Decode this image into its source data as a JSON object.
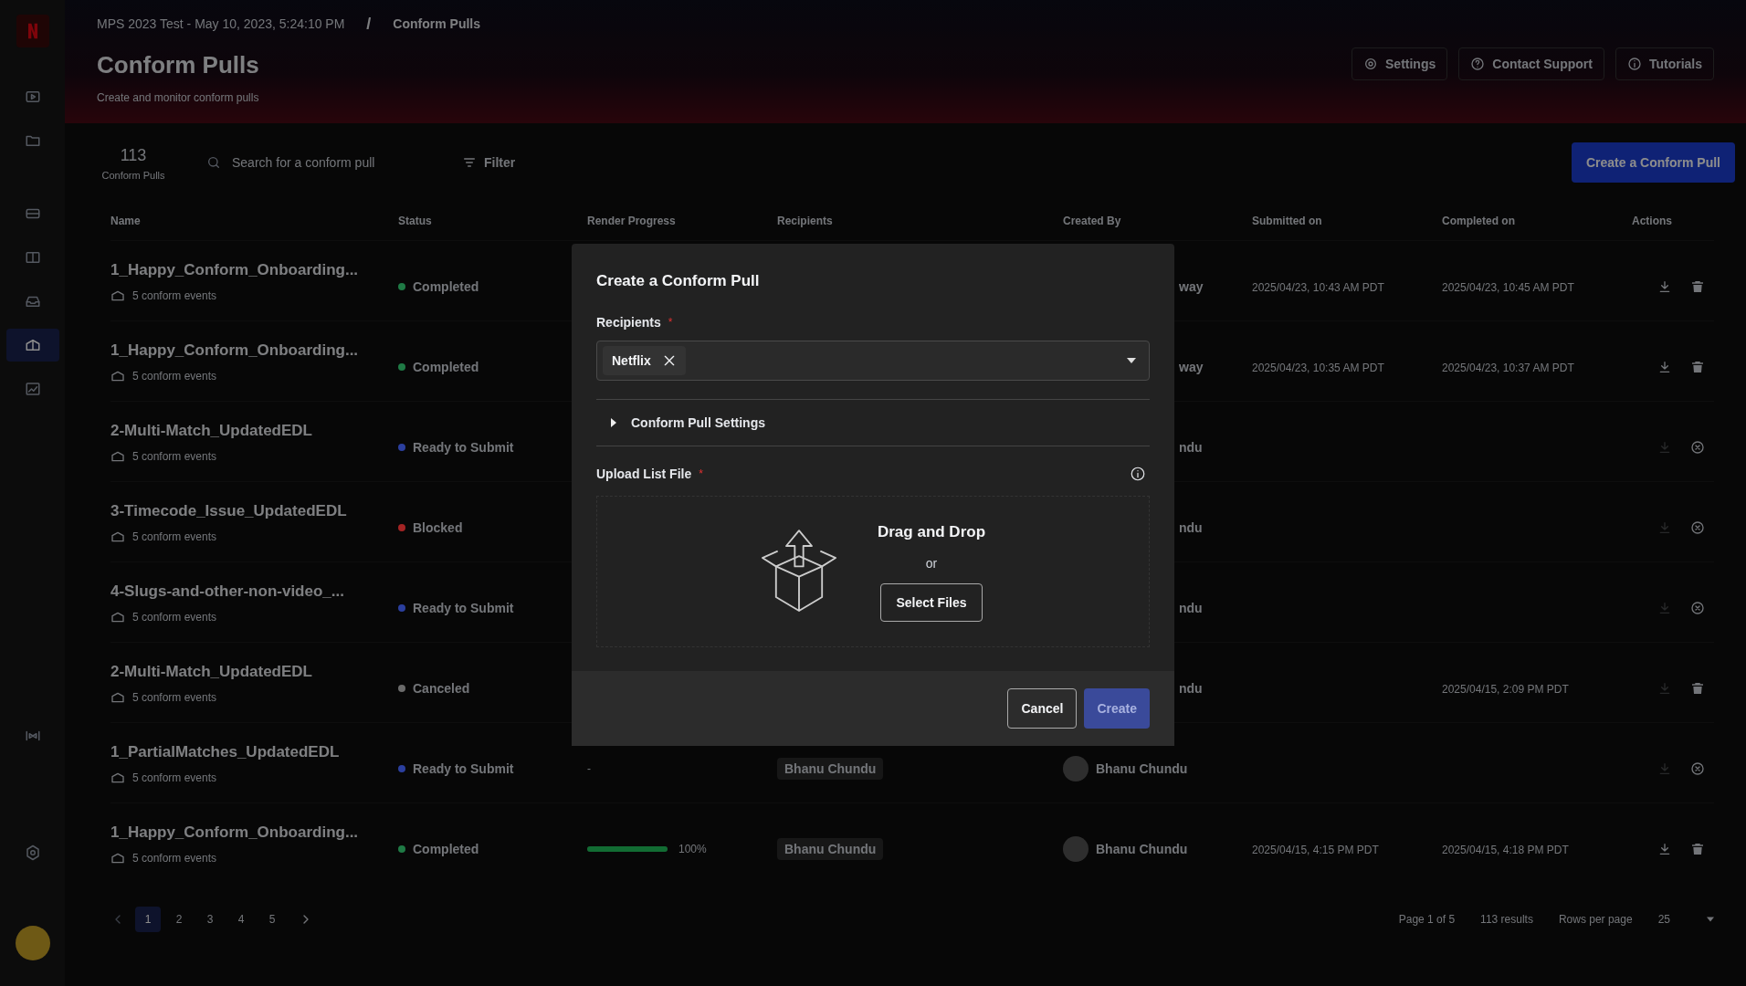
{
  "breadcrumb": [
    "MPS 2023 Test - May 10, 2023, 5:24:10 PM",
    "/",
    "Conform Pulls"
  ],
  "header": {
    "title": "Conform Pulls",
    "subtitle": "Create and monitor conform pulls",
    "buttons": [
      "Settings",
      "Contact Support",
      "Tutorials"
    ]
  },
  "sidebar": {
    "items": [
      {
        "kind": "tv",
        "selected": false
      },
      {
        "kind": "folder",
        "selected": false
      },
      {
        "kind": "drive",
        "selected": false
      },
      {
        "kind": "book",
        "selected": false
      },
      {
        "kind": "tray",
        "selected": false
      },
      {
        "kind": "box",
        "selected": true
      },
      {
        "kind": "chart",
        "selected": false
      }
    ],
    "bottom": [
      {
        "kind": "film"
      },
      {
        "kind": "gear"
      }
    ]
  },
  "toolbar": {
    "count": "113",
    "count_label": "Conform Pulls",
    "search_placeholder": "Search for a conform pull",
    "filter": "Filter",
    "create_button": "Create a Conform Pull"
  },
  "table": {
    "columns": [
      "Name",
      "Status",
      "Render Progress",
      "Recipients",
      "Created By",
      "Submitted on",
      "Completed on",
      "Actions"
    ],
    "rows": [
      {
        "name": "1_Happy_Conform_Onboarding...",
        "events": "5 conform events",
        "status": "Completed",
        "color": "#1f7a45",
        "created_by": {
          "text": "way",
          "avatar": false
        },
        "submitted": "2025/04/23, 10:43 AM PDT",
        "completed": "2025/04/23, 10:45 AM PDT",
        "actions": [
          {
            "kind": "download",
            "disabled": false
          },
          {
            "kind": "delete",
            "disabled": false
          }
        ]
      },
      {
        "name": "1_Happy_Conform_Onboarding...",
        "events": "5 conform events",
        "status": "Completed",
        "color": "#1f7a45",
        "created_by": {
          "text": "way",
          "avatar": false
        },
        "submitted": "2025/04/23, 10:35 AM PDT",
        "completed": "2025/04/23, 10:37 AM PDT",
        "actions": [
          {
            "kind": "download",
            "disabled": false
          },
          {
            "kind": "delete",
            "disabled": false
          }
        ]
      },
      {
        "name": "2-Multi-Match_UpdatedEDL",
        "events": "5 conform events",
        "status": "Ready to Submit",
        "color": "#2b3f9e",
        "created_by": {
          "text": "ndu",
          "avatar": false
        },
        "actions": [
          {
            "kind": "download",
            "disabled": true
          },
          {
            "kind": "cancel",
            "disabled": false
          }
        ]
      },
      {
        "name": "3-Timecode_Issue_UpdatedEDL",
        "events": "5 conform events",
        "status": "Blocked",
        "color": "#a32424",
        "created_by": {
          "text": "ndu",
          "avatar": false
        },
        "actions": [
          {
            "kind": "download",
            "disabled": true
          },
          {
            "kind": "cancel",
            "disabled": false
          }
        ]
      },
      {
        "name": "4-Slugs-and-other-non-video_...",
        "events": "5 conform events",
        "status": "Ready to Submit",
        "color": "#2b3f9e",
        "created_by": {
          "text": "ndu",
          "avatar": false
        },
        "actions": [
          {
            "kind": "download",
            "disabled": true
          },
          {
            "kind": "cancel",
            "disabled": false
          }
        ]
      },
      {
        "name": "2-Multi-Match_UpdatedEDL",
        "events": "5 conform events",
        "status": "Canceled",
        "color": "#6b6b6b",
        "created_by": {
          "text": "ndu",
          "avatar": false
        },
        "completed": "2025/04/15, 2:09 PM PDT",
        "actions": [
          {
            "kind": "download",
            "disabled": true
          },
          {
            "kind": "delete",
            "disabled": false
          }
        ]
      },
      {
        "name": "1_PartialMatches_UpdatedEDL",
        "events": "5 conform events",
        "status": "Ready to Submit",
        "color": "#2b3f9e",
        "progress_text": "-",
        "recipients": "Bhanu Chundu",
        "created_by": {
          "text": "Bhanu Chundu",
          "avatar": true
        },
        "actions": [
          {
            "kind": "download",
            "disabled": true
          },
          {
            "kind": "cancel",
            "disabled": false
          }
        ]
      },
      {
        "name": "1_Happy_Conform_Onboarding...",
        "events": "5 conform events",
        "status": "Completed",
        "color": "#1f7a45",
        "progress": {
          "level": 1,
          "text": "100%"
        },
        "recipients": "Bhanu Chundu",
        "created_by": {
          "text": "Bhanu Chundu",
          "avatar": true
        },
        "submitted": "2025/04/15, 4:15 PM PDT",
        "completed": "2025/04/15, 4:18 PM PDT",
        "actions": [
          {
            "kind": "download",
            "disabled": false
          },
          {
            "kind": "delete",
            "disabled": false
          }
        ]
      }
    ]
  },
  "pagination": {
    "pages": [
      {
        "label": "1",
        "selected": true
      },
      {
        "label": "2",
        "selected": false
      },
      {
        "label": "3",
        "selected": false
      },
      {
        "label": "4",
        "selected": false
      },
      {
        "label": "5",
        "selected": false
      }
    ],
    "page_info": "Page 1 of 5",
    "results": "113 results",
    "rows_label": "Rows per page",
    "rows_value": "25"
  },
  "dialog": {
    "title": "Create a Conform Pull",
    "recipients_label": "Recipients",
    "required_mark": "*",
    "chips": [
      "Netflix"
    ],
    "settings": {
      "label": "Conform Pull Settings",
      "expanded": false
    },
    "upload_label": "Upload List File",
    "upload_required_mark": "*",
    "drop_title": "Drag and Drop",
    "drop_or": "or",
    "select_button": "Select Files",
    "cancel": "Cancel",
    "create": {
      "label": "Create",
      "disabled": true
    }
  }
}
